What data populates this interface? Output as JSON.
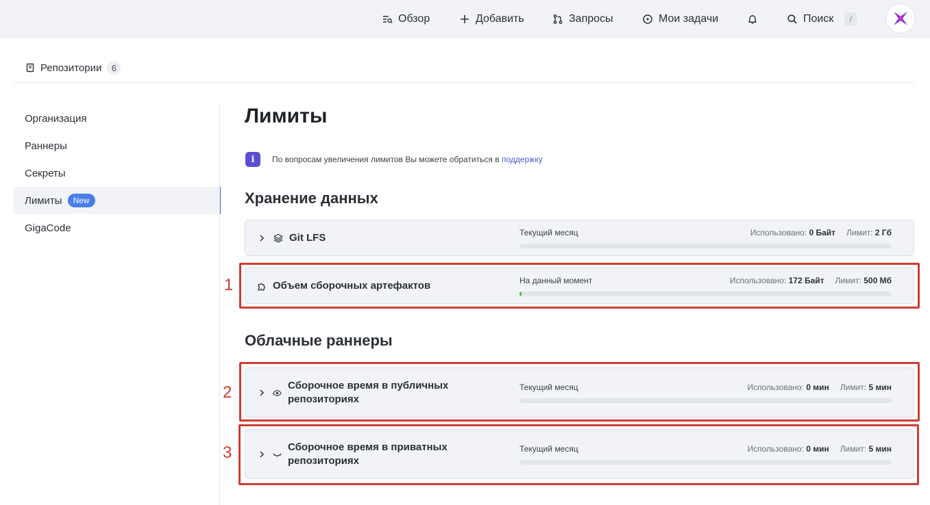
{
  "header": {
    "nav": [
      {
        "label": "Обзор",
        "icon": "overview-icon"
      },
      {
        "label": "Добавить",
        "icon": "plus-icon"
      },
      {
        "label": "Запросы",
        "icon": "pull-request-icon"
      },
      {
        "label": "Мои задачи",
        "icon": "circle-dot-icon"
      }
    ],
    "search_label": "Поиск",
    "search_shortcut": "/"
  },
  "tabs": {
    "repos_label": "Репозитории",
    "repos_count": "6"
  },
  "sidebar": {
    "items": [
      {
        "label": "Организация"
      },
      {
        "label": "Раннеры"
      },
      {
        "label": "Секреты"
      },
      {
        "label": "Лимиты",
        "badge": "New",
        "active": true
      },
      {
        "label": "GigaCode"
      }
    ]
  },
  "main": {
    "title": "Лимиты",
    "info_text": "По вопросам увеличения лимитов Вы можете обратиться в",
    "info_link": "поддержку",
    "storage_title": "Хранение данных",
    "runners_title": "Облачные раннеры",
    "used_label": "Использовано:",
    "limit_label": "Лимит:",
    "cards": [
      {
        "name": "Git LFS",
        "icon": "layers-icon",
        "period": "Текущий месяц",
        "used": "0 Байт",
        "limit": "2 Гб",
        "fill_fraction": 0
      },
      {
        "name": "Объем сборочных артефактов",
        "icon": "puzzle-icon",
        "period": "На данный момент",
        "used": "172 Байт",
        "limit": "500 Мб",
        "fill_fraction": 0.004
      },
      {
        "name": "Сборочное время в публичных репозиториях",
        "icon": "eye-icon",
        "period": "Текущий месяц",
        "used": "0 мин",
        "limit": "5 мин",
        "fill_fraction": 0
      },
      {
        "name": "Сборочное время в приватных репозиториях",
        "icon": "eye-closed-icon",
        "period": "Текущий месяц",
        "used": "0 мин",
        "limit": "5 мин",
        "fill_fraction": 0
      }
    ]
  },
  "annotations": [
    "1",
    "2",
    "3"
  ],
  "colors": {
    "accent": "#4a7de8",
    "annotation": "#cf3b35",
    "progress": "#3fbf5a",
    "info": "#5a4fcf"
  }
}
